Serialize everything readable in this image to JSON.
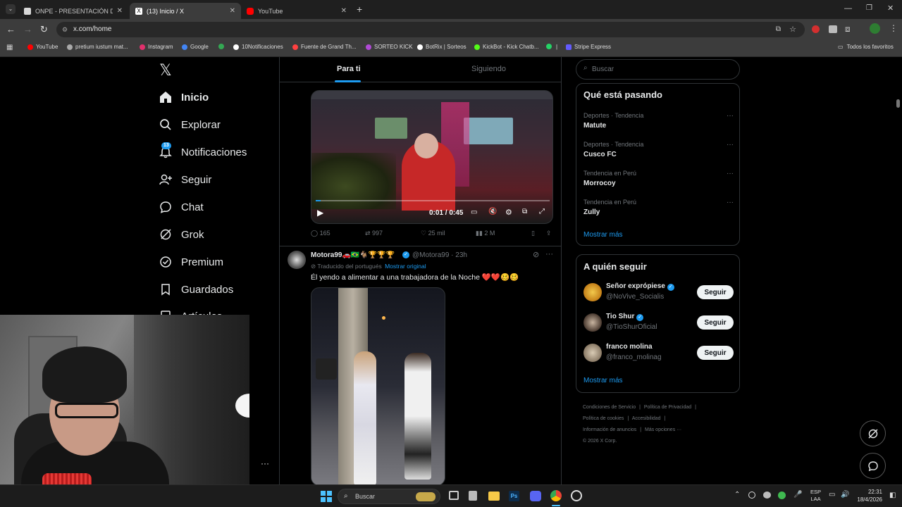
{
  "browser": {
    "tabs": [
      {
        "title": "ONPE - PRESENTACIÓN DE RES",
        "color": "#d8d8d8"
      },
      {
        "title": "(13) Inicio / X",
        "color": "#ffffff"
      },
      {
        "title": "YouTube",
        "color": "#ff0000"
      }
    ],
    "url": "x.com/home",
    "bookmarks": [
      {
        "label": "YouTube",
        "color": "#ff0000"
      },
      {
        "label": "pretium iustum mat...",
        "color": "#aaaaaa"
      },
      {
        "label": "Instagram",
        "color": "#e1306c"
      },
      {
        "label": "Google",
        "color": "#4285f4"
      },
      {
        "label": "",
        "color": "#34a853"
      },
      {
        "label": "10Notificaciones",
        "color": "#ffffff"
      },
      {
        "label": "Fuente de Grand Th...",
        "color": "#ff4040"
      },
      {
        "label": "SORTEO KICK",
        "color": "#b04ad6"
      },
      {
        "label": "BotRix | Sorteos",
        "color": "#ffffff"
      },
      {
        "label": "KickBot - Kick Chatb...",
        "color": "#53fc18"
      },
      {
        "label": "",
        "color": "#25d366"
      },
      {
        "label": "|",
        "color": "#888888"
      },
      {
        "label": "Stripe Express",
        "color": "#635bff"
      }
    ],
    "all_favorites": "Todos los favoritos"
  },
  "x": {
    "logo": "𝕏",
    "nav": [
      {
        "label": "Inicio",
        "icon": "home-icon",
        "bold": true
      },
      {
        "label": "Explorar",
        "icon": "search-icon"
      },
      {
        "label": "Notificaciones",
        "icon": "bell-icon",
        "badge": "13"
      },
      {
        "label": "Seguir",
        "icon": "add-user-icon"
      },
      {
        "label": "Chat",
        "icon": "chat-icon"
      },
      {
        "label": "Grok",
        "icon": "grok-icon"
      },
      {
        "label": "Premium",
        "icon": "premium-icon"
      },
      {
        "label": "Guardados",
        "icon": "bookmark-icon"
      },
      {
        "label": "Artículos",
        "icon": "article-icon"
      }
    ],
    "feed_tabs": [
      "Para ti",
      "Siguiendo"
    ],
    "video": {
      "time": "0:01 / 0:45"
    },
    "tweet1_stats": {
      "replies": "165",
      "retweets": "997",
      "likes": "25 mil",
      "views": "2 M"
    },
    "tweet2": {
      "name": "Motora99🚗🇧🇷🐐🏆🏆🏆",
      "handle": "@Motora99 · 23h",
      "translated": "Traducido del portugués",
      "show_original": "Mostrar original",
      "text": "Él yendo a alimentar a una trabajadora de la Noche ❤️❤️🥴🥴"
    },
    "search_placeholder": "Buscar",
    "trends_title": "Qué está pasando",
    "trends": [
      {
        "category": "Deportes · Tendencia",
        "name": "Matute"
      },
      {
        "category": "Deportes · Tendencia",
        "name": "Cusco FC"
      },
      {
        "category": "Tendencia en Perú",
        "name": "Morrocoy"
      },
      {
        "category": "Tendencia en Perú",
        "name": "Zully"
      }
    ],
    "show_more": "Mostrar más",
    "who_title": "A quién seguir",
    "who": [
      {
        "name": "Señor exprópiese",
        "handle": "@NoVive_Socialis",
        "verified": true,
        "button": "Seguir"
      },
      {
        "name": "Tio Shur",
        "handle": "@TioShurOficial",
        "verified": true,
        "button": "Seguir"
      },
      {
        "name": "franco molina",
        "handle": "@franco_molinag",
        "verified": false,
        "button": "Seguir"
      }
    ],
    "footer": [
      "Condiciones de Servicio",
      "|",
      "Política de Privacidad",
      "|",
      "Política de cookies",
      "|",
      "Accesibilidad",
      "|",
      "Información de anuncios",
      "|",
      "Más opciones ···",
      "© 2026 X Corp."
    ],
    "more_dots": "···"
  },
  "taskbar": {
    "search": "Buscar",
    "lang": "ESP",
    "layout": "LAA",
    "time": "22:31",
    "date": "18/4/2026"
  },
  "colors": {
    "accent": "#1d9bf0",
    "bg": "#000000",
    "border": "#2f3336"
  }
}
